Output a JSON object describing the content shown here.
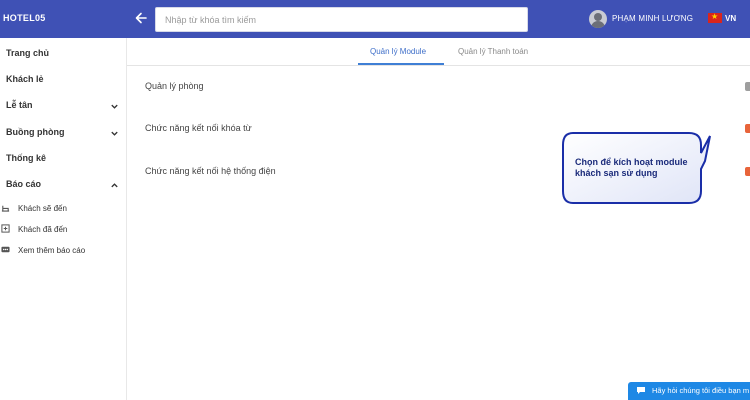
{
  "header": {
    "brand": "HOTEL05",
    "search_placeholder": "Nhập từ khóa tìm kiếm",
    "user_name": "PHẠM MINH LƯƠNG",
    "language": "VN"
  },
  "sidebar": {
    "items": [
      {
        "label": "Trang chủ"
      },
      {
        "label": "Khách lẻ"
      },
      {
        "label": "Lễ tân"
      },
      {
        "label": "Buồng phòng"
      },
      {
        "label": "Thống kê"
      },
      {
        "label": "Báo cáo"
      }
    ],
    "sub_items": [
      {
        "label": "Khách sẽ đến"
      },
      {
        "label": "Khách đã đến"
      },
      {
        "label": "Xem thêm báo cáo"
      }
    ]
  },
  "tabs": [
    {
      "label": "Quản lý Module",
      "active": true
    },
    {
      "label": "Quản lý Thanh toán",
      "active": false
    }
  ],
  "modules": [
    {
      "label": "Quản lý phòng",
      "enabled_color": "#9e9e9e"
    },
    {
      "label": "Chức năng kết nối khóa từ",
      "enabled_color": "#e8643a"
    },
    {
      "label": "Chức năng kết nối hệ thống điện",
      "enabled_color": "#e8643a"
    }
  ],
  "callout": {
    "text": "Chọn để kích hoạt module khách sạn sử dụng"
  },
  "chat": {
    "label": "Hãy hỏi chúng tôi điều bạn m"
  },
  "colors": {
    "header_bg": "#3f51b5",
    "accent": "#3f6fc9",
    "toggle_on": "#e8643a",
    "chat_bg": "#1e88e5"
  }
}
